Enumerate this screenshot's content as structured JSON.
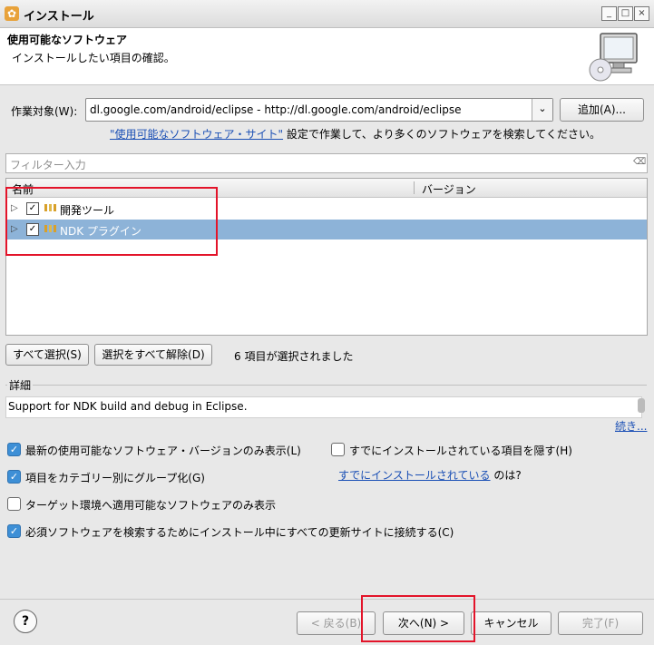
{
  "window": {
    "title": "インストール",
    "icon": "eclipse-install-icon",
    "min": "_",
    "max": "□",
    "close": "×"
  },
  "header": {
    "title": "使用可能なソフトウェア",
    "description": "インストールしたい項目の確認。"
  },
  "work_with": {
    "label": "作業対象(W):",
    "value": "dl.google.com/android/eclipse - http://dl.google.com/android/eclipse",
    "add_button": "追加(A)...",
    "site_link": "\"使用可能なソフトウェア・サイト\"",
    "site_suffix": " 設定で作業して、より多くのソフトウェアを検索してください。"
  },
  "filter": {
    "placeholder": "フィルター入力"
  },
  "tree": {
    "columns": {
      "name": "名前",
      "version": "バージョン"
    },
    "items": [
      {
        "label": "開発ツール",
        "checked": true,
        "expander": "▷",
        "icon": "package-icon",
        "selected": false
      },
      {
        "label": "NDK プラグイン",
        "checked": true,
        "expander": "▷",
        "icon": "package-icon",
        "selected": true
      }
    ]
  },
  "selection": {
    "select_all": "すべて選択(S)",
    "deselect_all": "選択をすべて解除(D)",
    "count_text": "6 項目が選択されました"
  },
  "details": {
    "label": "詳細",
    "text": "Support for NDK build and debug in Eclipse.",
    "more_link": "続き..."
  },
  "options": {
    "latest_only": {
      "label": "最新の使用可能なソフトウェア・バージョンのみ表示(L)",
      "checked": true
    },
    "hide_installed": {
      "label": "すでにインストールされている項目を隠す(H)",
      "checked": false
    },
    "group_by_category": {
      "label": "項目をカテゴリー別にグループ化(G)",
      "checked": true
    },
    "already_installed_link": "すでにインストールされている",
    "already_installed_suffix": " のは?",
    "target_env_only": {
      "label": "ターゲット環境へ適用可能なソフトウェアのみ表示",
      "checked": false
    },
    "contact_all_sites": {
      "label": "必須ソフトウェアを検索するためにインストール中にすべての更新サイトに接続する(C)",
      "checked": true
    }
  },
  "buttons": {
    "help": "?",
    "back": "< 戻る(B)",
    "next": "次へ(N) >",
    "cancel": "キャンセル",
    "finish": "完了(F)"
  },
  "colors": {
    "selection": "#8db3d8",
    "highlight_box": "#e3142a",
    "checkbox_on": "#3d8fd6",
    "link": "#1a4fb5"
  }
}
